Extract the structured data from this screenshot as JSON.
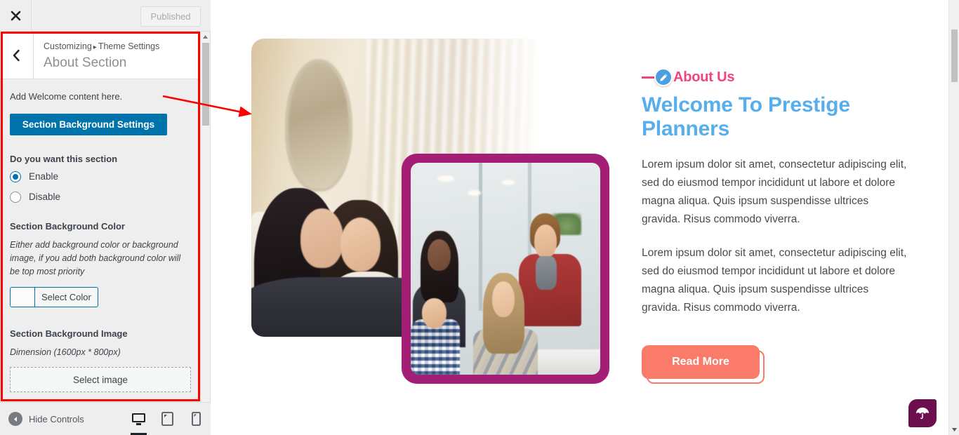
{
  "customizer": {
    "topbar": {
      "close_icon": "close-x-icon",
      "publish_label": "Published"
    },
    "section": {
      "back_icon": "chevron-left-icon",
      "breadcrumb_prefix": "Customizing",
      "breadcrumb_separator": "▸",
      "breadcrumb_parent": "Theme Settings",
      "title": "About Section"
    },
    "controls": {
      "help_text": "Add Welcome content here.",
      "bg_settings_button": "Section Background Settings",
      "enable_group_label": "Do you want this section",
      "radio_options": [
        {
          "label": "Enable",
          "checked": true
        },
        {
          "label": "Disable",
          "checked": false
        }
      ],
      "bg_color_label": "Section Background Color",
      "bg_color_desc": "Either add background color or background image, if you add both background color will be top most priority",
      "select_color_button": "Select Color",
      "bg_image_label": "Section Background Image",
      "bg_image_dimension": "Dimension (1600px * 800px)",
      "select_image_button": "Select image"
    },
    "bottom": {
      "hide_controls_label": "Hide Controls",
      "devices": [
        {
          "name": "desktop",
          "icon": "desktop-icon",
          "active": true
        },
        {
          "name": "tablet",
          "icon": "tablet-icon",
          "active": false
        },
        {
          "name": "mobile",
          "icon": "mobile-icon",
          "active": false
        }
      ]
    },
    "colors": {
      "primary_button": "#0073aa",
      "annotation": "#ff0000",
      "panel_bg": "#eeeeee"
    }
  },
  "preview": {
    "about": {
      "eyebrow": "About Us",
      "edit_icon": "pencil-edit-icon",
      "heading": "Welcome To Prestige Planners",
      "paragraph1": "Lorem ipsum dolor sit amet, consectetur adipiscing elit, sed do eiusmod tempor incididunt ut labore et dolore magna aliqua. Quis ipsum suspendisse ultrices gravida. Risus commodo viverra.",
      "paragraph2": "Lorem ipsum dolor sit amet, consectetur adipiscing elit, sed do eiusmod tempor incididunt ut labore et dolore magna aliqua. Quis ipsum suspendisse ultrices gravida. Risus commodo viverra.",
      "read_more_button": "Read More",
      "image1_alt": "two-women-with-laptop-photo",
      "image2_alt": "office-team-meeting-photo"
    },
    "scroll_top_icon": "umbrella-icon",
    "colors": {
      "eyebrow": "#f2447b",
      "heading": "#56aeec",
      "button": "#fb7b6b",
      "frame": "#a31e74",
      "scroll_top_bg": "#6d0f4e"
    }
  }
}
